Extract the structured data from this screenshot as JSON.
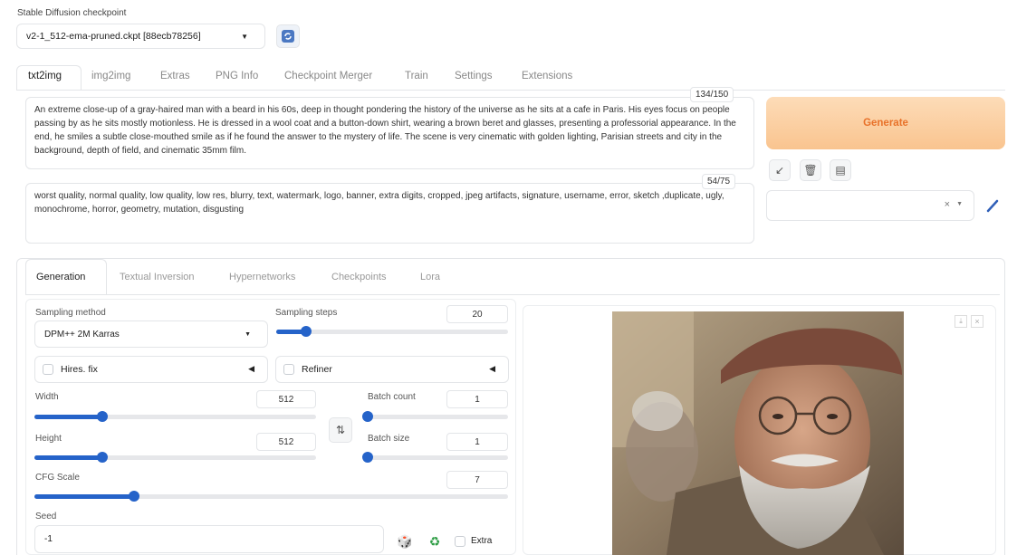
{
  "checkpoint": {
    "label": "Stable Diffusion checkpoint",
    "value": "v2-1_512-ema-pruned.ckpt [88ecb78256]"
  },
  "tabs": [
    "txt2img",
    "img2img",
    "Extras",
    "PNG Info",
    "Checkpoint Merger",
    "Train",
    "Settings",
    "Extensions"
  ],
  "prompt": {
    "text": "An extreme close-up of a gray-haired man with a beard in his 60s, deep in thought pondering the history of the universe as he sits at a cafe in Paris. His eyes focus on people passing by as he sits mostly motionless. He is dressed in a wool coat and a button-down shirt, wearing a brown beret and glasses, presenting a professorial appearance. In the end, he smiles a subtle close-mouthed smile as if he found the answer to the mystery of life. The scene is very cinematic with golden lighting, Parisian streets and city in the background, depth of field, and cinematic 35mm film.",
    "counter": "134/150"
  },
  "negative_prompt": {
    "text": "worst quality, normal quality, low quality, low res, blurry, text, watermark, logo, banner, extra digits, cropped, jpeg artifacts, signature, username, error, sketch ,duplicate, ugly, monochrome, horror, geometry, mutation, disgusting",
    "counter": "54/75"
  },
  "generate_label": "Generate",
  "style_clear": "×",
  "subtabs": [
    "Generation",
    "Textual Inversion",
    "Hypernetworks",
    "Checkpoints",
    "Lora"
  ],
  "sampling_method": {
    "label": "Sampling method",
    "value": "DPM++ 2M Karras"
  },
  "sampling_steps": {
    "label": "Sampling steps",
    "value": "20",
    "fraction": 0.13
  },
  "hires_fix": {
    "label": "Hires. fix"
  },
  "refiner": {
    "label": "Refiner"
  },
  "width": {
    "label": "Width",
    "value": "512",
    "fraction": 0.24
  },
  "height": {
    "label": "Height",
    "value": "512",
    "fraction": 0.24
  },
  "batch_count": {
    "label": "Batch count",
    "value": "1",
    "fraction": 0.0
  },
  "batch_size": {
    "label": "Batch size",
    "value": "1",
    "fraction": 0.0
  },
  "cfg_scale": {
    "label": "CFG Scale",
    "value": "7",
    "fraction": 0.21
  },
  "seed": {
    "label": "Seed",
    "value": "-1",
    "extra_label": "Extra"
  },
  "swap_label": "⇅",
  "colors": {
    "accent": "#2563c9",
    "generate_text": "#e8722a",
    "generate_bg": "#fcd9b3"
  }
}
